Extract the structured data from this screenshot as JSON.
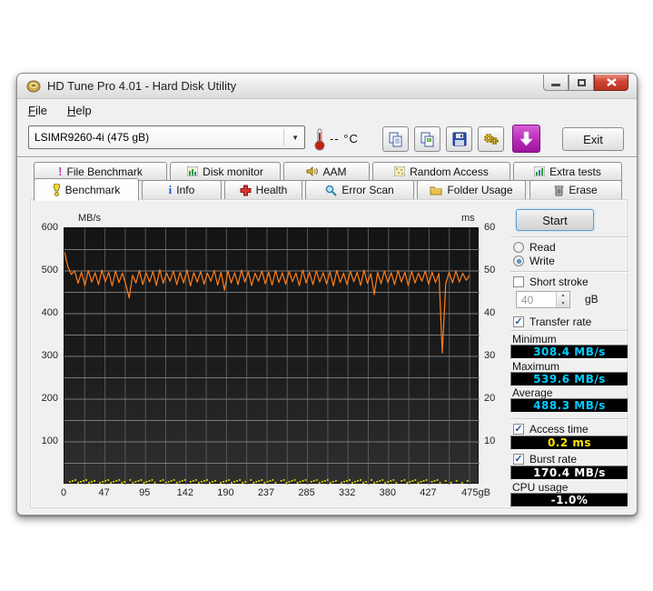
{
  "window": {
    "title": "HD Tune Pro 4.01 - Hard Disk Utility"
  },
  "menu": {
    "items": [
      {
        "key": "F",
        "rest": "ile"
      },
      {
        "key": "H",
        "rest": "elp"
      }
    ]
  },
  "toolbar": {
    "drive_select": {
      "value": "LSIMR9260-4i (475 gB)"
    },
    "temperature": {
      "value": "--",
      "unit": "°C"
    },
    "buttons": [
      "copy-text",
      "copy-image",
      "save",
      "options",
      "download"
    ],
    "exit_label": "Exit"
  },
  "tabs": {
    "top": [
      {
        "label": "File Benchmark",
        "icon": "file-benchmark-icon"
      },
      {
        "label": "Disk monitor",
        "icon": "disk-monitor-icon"
      },
      {
        "label": "AAM",
        "icon": "aam-speaker-icon"
      },
      {
        "label": "Random Access",
        "icon": "random-access-icon"
      },
      {
        "label": "Extra tests",
        "icon": "extra-tests-icon"
      }
    ],
    "bottom": [
      {
        "label": "Benchmark",
        "icon": "benchmark-icon",
        "active": true
      },
      {
        "label": "Info",
        "icon": "info-icon"
      },
      {
        "label": "Health",
        "icon": "health-icon"
      },
      {
        "label": "Error Scan",
        "icon": "error-scan-icon"
      },
      {
        "label": "Folder Usage",
        "icon": "folder-usage-icon"
      },
      {
        "label": "Erase",
        "icon": "erase-icon"
      }
    ]
  },
  "panel": {
    "start_label": "Start",
    "read_label": "Read",
    "write_label": "Write",
    "read_selected": false,
    "write_selected": true,
    "short_stroke": {
      "label": "Short stroke",
      "checked": false,
      "value": "40",
      "unit": "gB"
    },
    "transfer_rate": {
      "label": "Transfer rate",
      "checked": true,
      "minimum_label": "Minimum",
      "minimum_value": "308.4 MB/s",
      "maximum_label": "Maximum",
      "maximum_value": "539.6 MB/s",
      "average_label": "Average",
      "average_value": "488.3 MB/s"
    },
    "access_time": {
      "label": "Access time",
      "checked": true,
      "value": "0.2 ms"
    },
    "burst_rate": {
      "label": "Burst rate",
      "checked": true,
      "value": "170.4 MB/s"
    },
    "cpu_usage": {
      "label": "CPU usage",
      "value": "-1.0%"
    }
  },
  "chart_data": {
    "type": "line",
    "title": "Write benchmark transfer rate",
    "grid": true,
    "left_axis": {
      "label": "MB/s",
      "min": 0,
      "max": 600,
      "ticks": [
        "600",
        "500",
        "400",
        "300",
        "200",
        "100"
      ],
      "gridline_step": 50
    },
    "right_axis": {
      "label": "ms",
      "min": 0,
      "max": 60,
      "ticks": [
        "60",
        "50",
        "40",
        "30",
        "20",
        "10"
      ]
    },
    "x_axis": {
      "unit": "gB",
      "min": 0,
      "max": 475,
      "ticks": [
        "0",
        "47",
        "95",
        "142",
        "190",
        "237",
        "285",
        "332",
        "380",
        "427",
        "475gB"
      ],
      "gridline_step_gb": 23.75
    },
    "series": [
      {
        "name": "transfer-rate",
        "unit": "MB/s",
        "color": "#ff7f1e",
        "axis": "left",
        "x_range_gb": [
          0,
          475
        ],
        "values": [
          545,
          510,
          492,
          500,
          471,
          497,
          466,
          501,
          474,
          496,
          468,
          502,
          475,
          497,
          465,
          500,
          473,
          495,
          469,
          437,
          490,
          472,
          501,
          468,
          496,
          474,
          499,
          466,
          503,
          471,
          495,
          476,
          500,
          468,
          497,
          472,
          502,
          465,
          496,
          474,
          499,
          469,
          495,
          476,
          501,
          467,
          497,
          455,
          500,
          472,
          496,
          468,
          502,
          474,
          498,
          466,
          495,
          476,
          500,
          470,
          497,
          467,
          501,
          473,
          496,
          469,
          499,
          475,
          495,
          466,
          502,
          472,
          497,
          468,
          500,
          474,
          496,
          470,
          498,
          465,
          501,
          473,
          495,
          468,
          499,
          475,
          497,
          466,
          502,
          471,
          494,
          445,
          497,
          470,
          500,
          473,
          496,
          468,
          501,
          474,
          497,
          466,
          499,
          472,
          495,
          476,
          500,
          469,
          497,
          473,
          494,
          308,
          470,
          497,
          472,
          500,
          474,
          495,
          478,
          490
        ]
      },
      {
        "name": "access-time",
        "unit": "ms",
        "color": "#d8d800",
        "axis": "right",
        "style": "dots-along-bottom",
        "avg_ms": 0.2
      }
    ]
  },
  "colors": {
    "transfer_line": "#ff7f1e",
    "access_dots": "#d8d800",
    "value_cyan": "#00ccff",
    "value_yellow": "#ffe400",
    "value_white": "#ffffff"
  }
}
